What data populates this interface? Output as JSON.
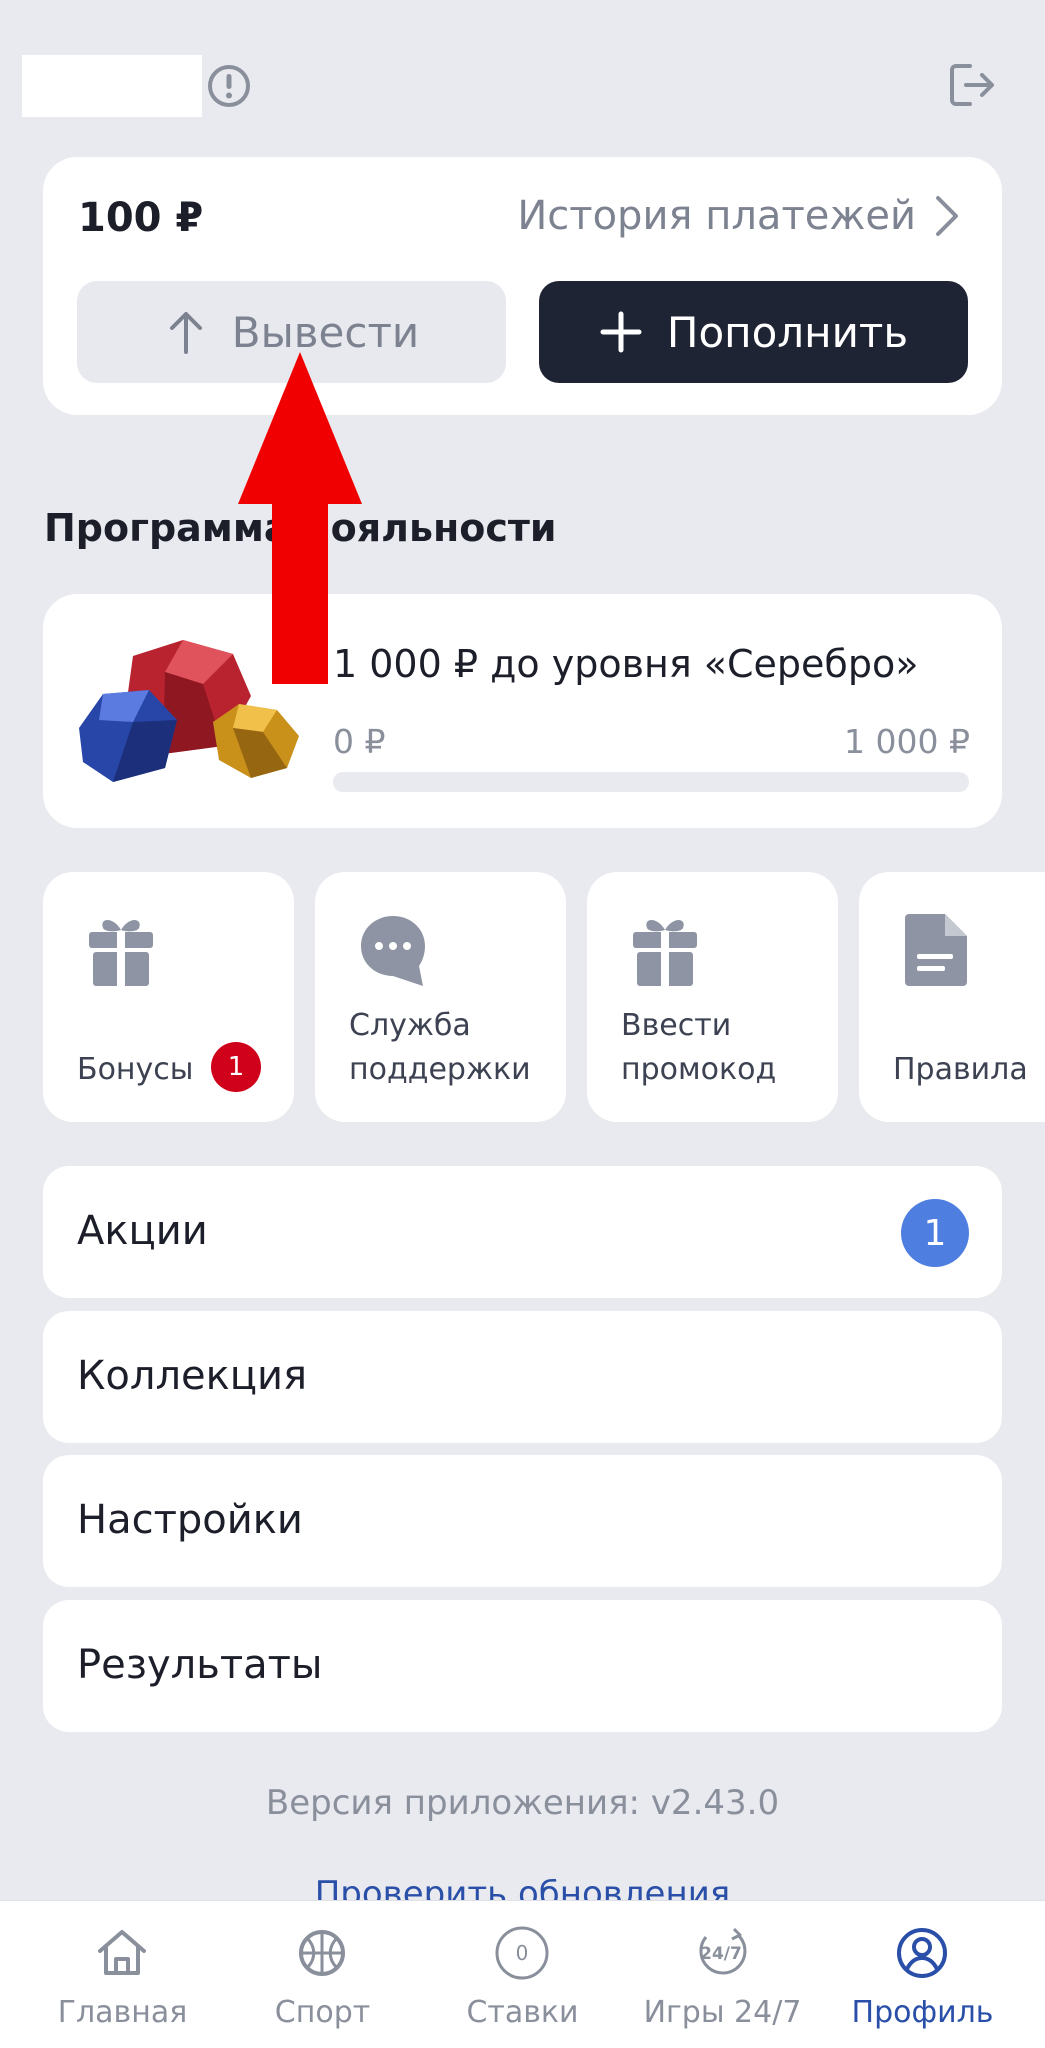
{
  "balance": {
    "amount": "100 ₽",
    "history_link": "История платежей",
    "withdraw_label": "Вывести",
    "deposit_label": "Пополнить"
  },
  "loyalty": {
    "section_title": "Программа лояльности",
    "target_text": "1 000 ₽ до уровня «Серебро»",
    "progress_min": "0 ₽",
    "progress_max": "1 000 ₽",
    "progress_fraction": 0
  },
  "tiles": [
    {
      "label": "Бонусы",
      "badge": "1",
      "icon": "gift-icon"
    },
    {
      "label": "Служба поддержки",
      "icon": "chat-bubble-icon"
    },
    {
      "label": "Ввести промокод",
      "icon": "gift-icon"
    },
    {
      "label": "Правила",
      "icon": "document-icon"
    }
  ],
  "menu": [
    {
      "label": "Акции",
      "badge": "1"
    },
    {
      "label": "Коллекция"
    },
    {
      "label": "Настройки"
    },
    {
      "label": "Результаты"
    }
  ],
  "footer": {
    "version": "Версия приложения: v2.43.0",
    "check_updates": "Проверить обновления"
  },
  "tabbar": [
    {
      "label": "Главная",
      "icon": "home-icon"
    },
    {
      "label": "Спорт",
      "icon": "basketball-icon"
    },
    {
      "label": "Ставки",
      "icon": "bet-slip-icon",
      "count": "0"
    },
    {
      "label": "Игры 24/7",
      "icon": "games-24-7-icon",
      "icon_text": "24/7"
    },
    {
      "label": "Профиль",
      "icon": "profile-icon",
      "active": true
    }
  ],
  "colors": {
    "background": "#e9eaef",
    "card": "#ffffff",
    "primary_dark": "#1f2434",
    "accent_blue": "#4e7ee0",
    "badge_red": "#d0021b",
    "active_tab": "#2a4fa8",
    "annotation_arrow": "#f00000"
  }
}
